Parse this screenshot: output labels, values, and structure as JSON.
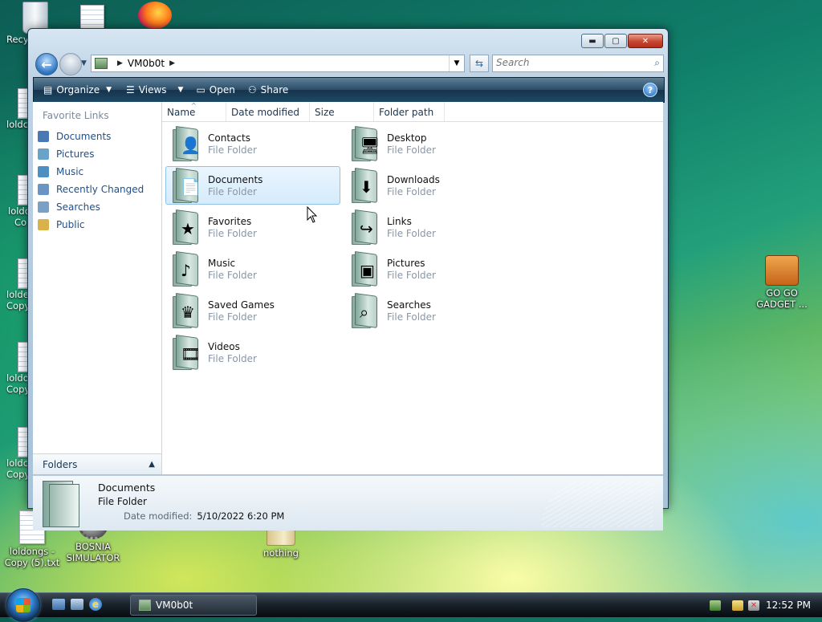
{
  "desktop": {
    "icons": [
      {
        "label": "Recy"
      },
      {
        "label": "loldc"
      },
      {
        "label": "loldo"
      },
      {
        "label": "Co"
      },
      {
        "label": "lolde"
      },
      {
        "label": "Copy"
      },
      {
        "label": "loldo"
      },
      {
        "label": "Copy"
      },
      {
        "label": "loldc"
      },
      {
        "label": "Copy"
      },
      {
        "label": "loldongs - Copy (5).txt"
      },
      {
        "label": "BOSNIA SIMULATOR"
      },
      {
        "label": "nothing"
      },
      {
        "label": "GO GO GADGET ..."
      }
    ]
  },
  "window": {
    "address": {
      "path": "VM0b0t"
    },
    "search": {
      "placeholder": "Search"
    },
    "toolbar": {
      "organize": "Organize",
      "views": "Views",
      "open": "Open",
      "share": "Share"
    },
    "nav_pane": {
      "header": "Favorite Links",
      "links": [
        {
          "label": "Documents",
          "color": "#4a78b5"
        },
        {
          "label": "Pictures",
          "color": "#6aa3c8"
        },
        {
          "label": "Music",
          "color": "#4c8fc0"
        },
        {
          "label": "Recently Changed",
          "color": "#6a94c2"
        },
        {
          "label": "Searches",
          "color": "#7aa0c4"
        },
        {
          "label": "Public",
          "color": "#d9b24a"
        }
      ],
      "folders_label": "Folders"
    },
    "columns": [
      "Name",
      "Date modified",
      "Size",
      "Folder path"
    ],
    "items": [
      {
        "name": "Contacts",
        "type": "File Folder",
        "icon": "contacts-icon",
        "glyph": "👤"
      },
      {
        "name": "Desktop",
        "type": "File Folder",
        "icon": "desktop-icon",
        "glyph": "🖥"
      },
      {
        "name": "Documents",
        "type": "File Folder",
        "icon": "documents-icon",
        "glyph": "📄"
      },
      {
        "name": "Downloads",
        "type": "File Folder",
        "icon": "downloads-icon",
        "glyph": "⬇"
      },
      {
        "name": "Favorites",
        "type": "File Folder",
        "icon": "favorites-icon",
        "glyph": "★"
      },
      {
        "name": "Links",
        "type": "File Folder",
        "icon": "links-icon",
        "glyph": "↪"
      },
      {
        "name": "Music",
        "type": "File Folder",
        "icon": "music-icon",
        "glyph": "♪"
      },
      {
        "name": "Pictures",
        "type": "File Folder",
        "icon": "pictures-icon",
        "glyph": "▣"
      },
      {
        "name": "Saved Games",
        "type": "File Folder",
        "icon": "saved-games-icon",
        "glyph": "♛"
      },
      {
        "name": "Searches",
        "type": "File Folder",
        "icon": "searches-icon",
        "glyph": "⌕"
      },
      {
        "name": "Videos",
        "type": "File Folder",
        "icon": "videos-icon",
        "glyph": "🎞"
      }
    ],
    "details": {
      "name": "Documents",
      "type": "File Folder",
      "modified_label": "Date modified:",
      "modified_value": "5/10/2022 6:20 PM"
    }
  },
  "taskbar": {
    "task_label": "VM0b0t",
    "clock": "12:52 PM"
  },
  "colors": {
    "accent": "#1d4f8c",
    "selection": "#d5ebfc"
  }
}
